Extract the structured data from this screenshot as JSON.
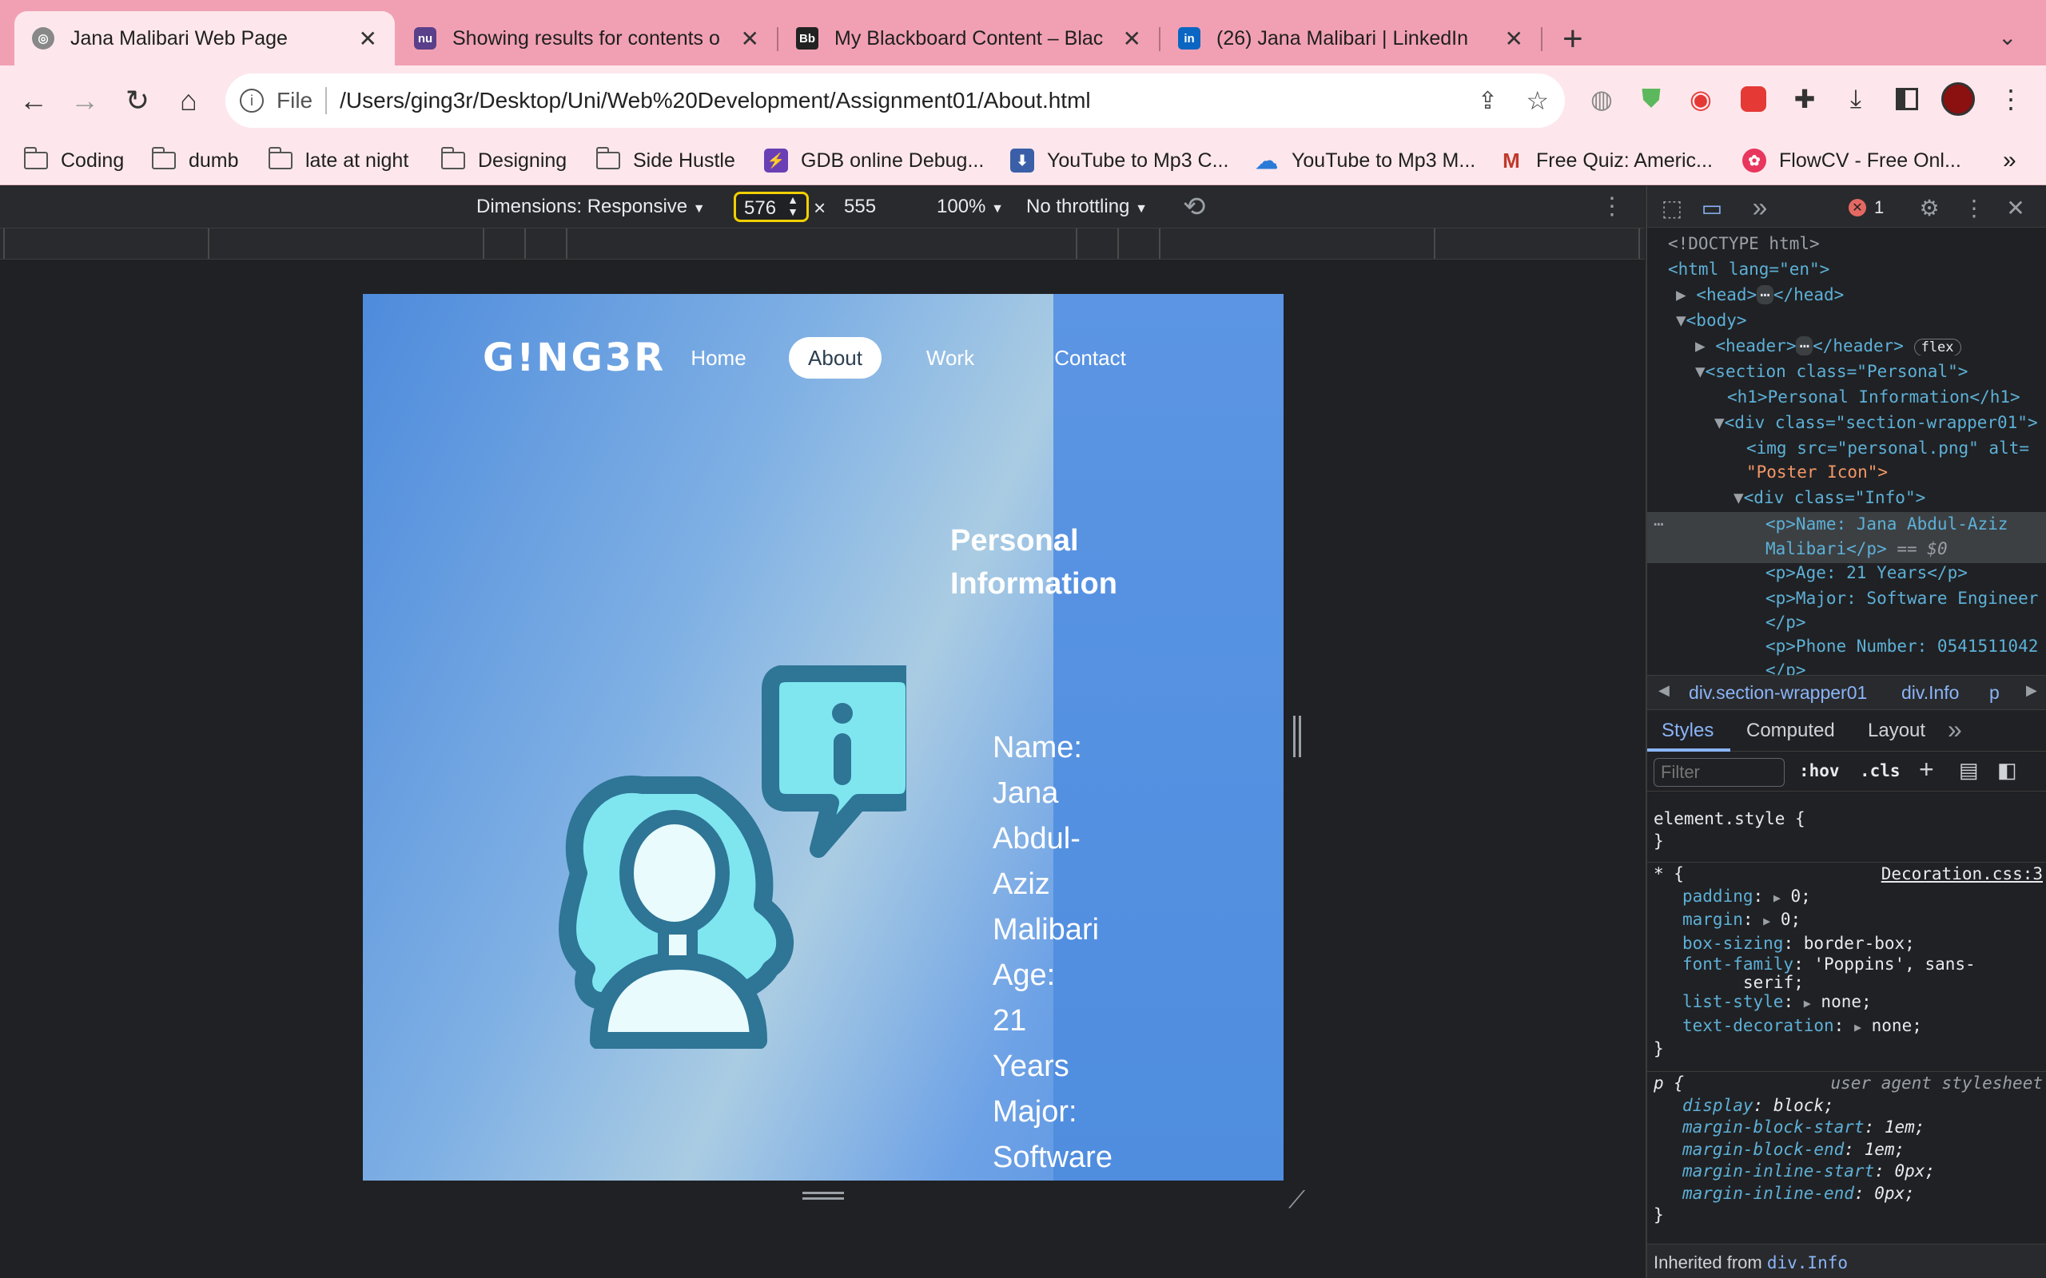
{
  "tabs": [
    {
      "title": "Jana Malibari Web Page",
      "favicon": "globe-icon"
    },
    {
      "title": "Showing results for contents o",
      "favicon": "nu-icon"
    },
    {
      "title": "My Blackboard Content – Blac",
      "favicon": "blackboard-icon"
    },
    {
      "title": "(26) Jana Malibari | LinkedIn",
      "favicon": "linkedin-icon"
    }
  ],
  "toolbar": {
    "file_label": "File",
    "url": "/Users/ging3r/Desktop/Uni/Web%20Development/Assignment01/About.html"
  },
  "bookmarks": [
    "Coding",
    "dumb",
    "late at night",
    "Designing",
    "Side Hustle",
    "GDB online Debug...",
    "YouTube to Mp3 C...",
    "YouTube to Mp3 M...",
    "Free Quiz: Americ...",
    "FlowCV - Free Onl..."
  ],
  "device_toolbar": {
    "dimensions": "Dimensions: Responsive",
    "width": "576",
    "times": "×",
    "height": "555",
    "zoom": "100%",
    "throttling": "No throttling"
  },
  "page": {
    "logo": "G!NG3R",
    "nav": [
      "Home",
      "About",
      "Work",
      "Contact"
    ],
    "active_nav": "About",
    "section_title_line1": "Personal",
    "section_title_line2": "Information",
    "info_lines": [
      "Name:",
      "Jana",
      "Abdul-",
      "Aziz",
      "Malibari",
      "Age:",
      "21",
      "Years",
      "Major:",
      "Software"
    ]
  },
  "devtools": {
    "error_count": "1",
    "dom": [
      "<!DOCTYPE html>",
      "<html lang=\"en\">",
      "<head>",
      "</head>",
      "<body>",
      "<header>",
      "</header>",
      "flex",
      "<section class=\"Personal\">",
      "<h1>Personal Information</h1>",
      "<div class=\"section-wrapper01\">",
      "<img src=\"personal.png\" alt=",
      "\"Poster Icon\">",
      "<div class=\"Info\">",
      "<p>Name: Jana Abdul-Aziz",
      "Malibari</p>",
      "== $0",
      "<p>Age: 21 Years</p>",
      "<p>Major: Software Engineer",
      "</p>",
      "<p>Phone Number: 0541511042",
      "</p>"
    ],
    "breadcrumb": [
      "div.section-wrapper01",
      "div.Info",
      "p"
    ],
    "panel_tabs": [
      "Styles",
      "Computed",
      "Layout"
    ],
    "filter_placeholder": "Filter",
    "hov": ":hov",
    "cls": ".cls",
    "element_style": "element.style {",
    "close_brace": "}",
    "rule1_selector": "* {",
    "rule1_source": "Decoration.css:3",
    "rule1_props": [
      {
        "name": "padding",
        "value": "0;"
      },
      {
        "name": "margin",
        "value": "0;"
      },
      {
        "name": "box-sizing",
        "value": "border-box;"
      },
      {
        "name": "font-family",
        "value": "'Poppins', sans-"
      },
      {
        "name": "",
        "value": "serif;"
      },
      {
        "name": "list-style",
        "value": "none;"
      },
      {
        "name": "text-decoration",
        "value": "none;"
      }
    ],
    "rule2_selector": "p {",
    "rule2_source": "user agent stylesheet",
    "rule2_props": [
      {
        "name": "display",
        "value": "block;"
      },
      {
        "name": "margin-block-start",
        "value": "1em;"
      },
      {
        "name": "margin-block-end",
        "value": "1em;"
      },
      {
        "name": "margin-inline-start",
        "value": "0px;"
      },
      {
        "name": "margin-inline-end",
        "value": "0px;"
      }
    ],
    "inherited_label": "Inherited from",
    "inherited_from": "div.Info"
  },
  "colors": {
    "tabstrip": "#f1a0b3",
    "toolbar": "#fde7ec",
    "page_gradient_start": "#4e8bdc",
    "icon_dark": "#2e7596",
    "icon_light": "#7fe6f0"
  }
}
